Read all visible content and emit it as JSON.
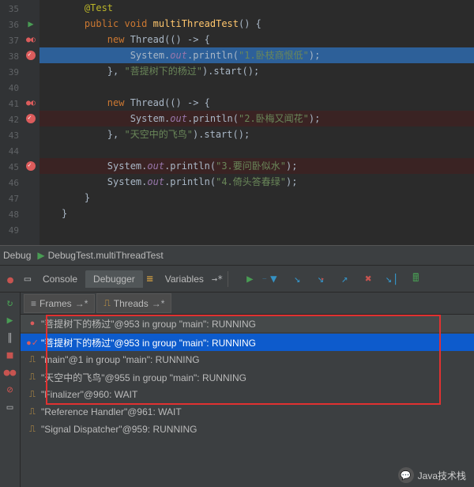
{
  "editor": {
    "lines": [
      {
        "n": 35,
        "marker": "",
        "cls": "",
        "html": "    <span class='tok-ann'>@Test</span>"
      },
      {
        "n": 36,
        "marker": "run",
        "cls": "",
        "html": "    <span class='tok-kw'>public void</span> <span class='tok-mname'>multiThreadTest</span><span class='tok-txt'>() {</span>"
      },
      {
        "n": 37,
        "marker": "bp-s",
        "cls": "",
        "html": "        <span class='tok-kw'>new</span> <span class='tok-txt'>Thread(() -&gt; {</span>"
      },
      {
        "n": 38,
        "marker": "bp-c",
        "cls": "hl-exec",
        "html": "            <span class='tok-txt'>System.</span><span class='tok-static'>out</span><span class='tok-txt'>.println(</span><span class='tok-str'>\"1.卧枝商恨低\"</span><span class='tok-txt'>);</span>"
      },
      {
        "n": 39,
        "marker": "",
        "cls": "",
        "html": "        <span class='tok-txt'>}, </span><span class='tok-str'>\"菩提树下的杨过\"</span><span class='tok-txt'>).start();</span>"
      },
      {
        "n": 40,
        "marker": "",
        "cls": "",
        "html": ""
      },
      {
        "n": 41,
        "marker": "bp-s",
        "cls": "",
        "html": "        <span class='tok-kw'>new</span> <span class='tok-txt'>Thread(() -&gt; {</span>"
      },
      {
        "n": 42,
        "marker": "bp-c",
        "cls": "hl-bp",
        "html": "            <span class='tok-txt'>System.</span><span class='tok-static'>out</span><span class='tok-txt'>.println(</span><span class='tok-str'>\"2.卧梅又闻花\"</span><span class='tok-txt'>);</span>"
      },
      {
        "n": 43,
        "marker": "",
        "cls": "",
        "html": "        <span class='tok-txt'>}, </span><span class='tok-str'>\"天空中的飞鸟\"</span><span class='tok-txt'>).start();</span>"
      },
      {
        "n": 44,
        "marker": "",
        "cls": "",
        "html": ""
      },
      {
        "n": 45,
        "marker": "bp-c",
        "cls": "hl-bp",
        "html": "        <span class='tok-txt'>System.</span><span class='tok-static'>out</span><span class='tok-txt'>.println(</span><span class='tok-str'>\"3.要问卧似水\"</span><span class='tok-txt'>);</span>"
      },
      {
        "n": 46,
        "marker": "",
        "cls": "",
        "html": "        <span class='tok-txt'>System.</span><span class='tok-static'>out</span><span class='tok-txt'>.println(</span><span class='tok-str'>\"4.倚头答春绿\"</span><span class='tok-txt'>);</span>"
      },
      {
        "n": 47,
        "marker": "",
        "cls": "",
        "html": "    <span class='tok-txt'>}</span>"
      },
      {
        "n": 48,
        "marker": "",
        "cls": "",
        "html": "<span class='tok-txt'>}</span>"
      },
      {
        "n": 49,
        "marker": "",
        "cls": "",
        "html": ""
      }
    ]
  },
  "debug_header": {
    "label": "Debug",
    "config": "DebugTest.multiThreadTest"
  },
  "tabs": {
    "console": "Console",
    "debugger": "Debugger",
    "variables": "Variables"
  },
  "frames": {
    "frames_label": "Frames",
    "threads_label": "Threads"
  },
  "threads": {
    "top": "\"菩提树下的杨过\"@953 in group \"main\": RUNNING",
    "list": [
      {
        "label": "\"菩提树下的杨过\"@953 in group \"main\": RUNNING",
        "sel": true,
        "ic": "bp"
      },
      {
        "label": "\"main\"@1 in group \"main\": RUNNING",
        "sel": false,
        "ic": "th"
      },
      {
        "label": "\"天空中的飞鸟\"@955 in group \"main\": RUNNING",
        "sel": false,
        "ic": "th"
      },
      {
        "label": "\"Finalizer\"@960: WAIT",
        "sel": false,
        "ic": "th"
      },
      {
        "label": "\"Reference Handler\"@961: WAIT",
        "sel": false,
        "ic": "th"
      },
      {
        "label": "\"Signal Dispatcher\"@959: RUNNING",
        "sel": false,
        "ic": "th"
      }
    ]
  },
  "watermark": "Java技术栈"
}
